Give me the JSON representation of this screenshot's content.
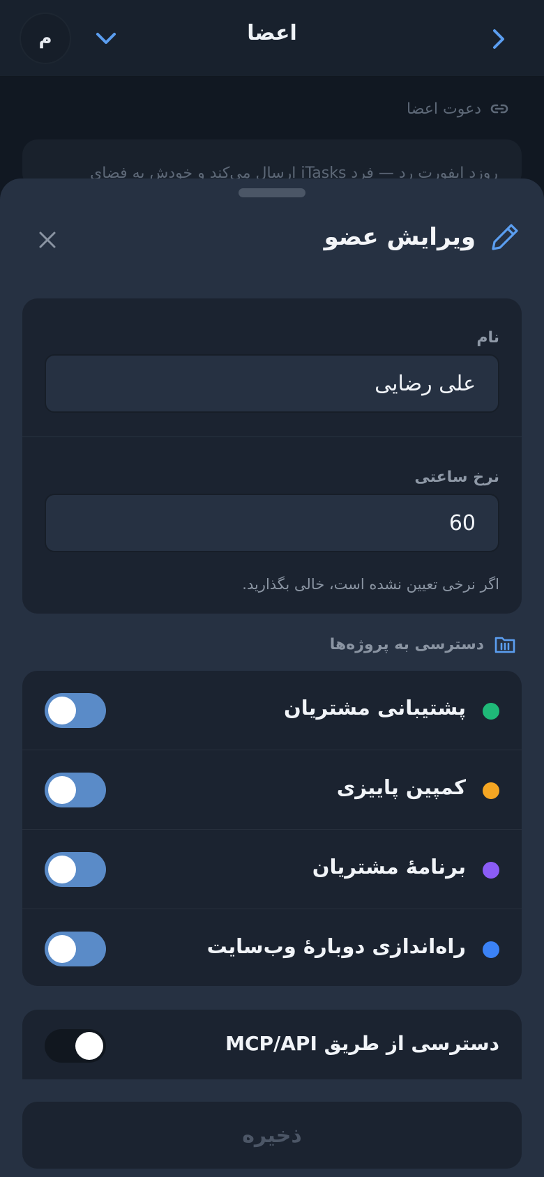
{
  "header": {
    "title": "اعضا",
    "avatar_initial": "م"
  },
  "background": {
    "invite_label": "دعوت اعضا",
    "invite_card_text": "رو‌زد ایفورت رد — فرد iTasks ارسال می‌کند و خودش به فضای"
  },
  "sheet": {
    "title": "ویرایش عضو",
    "name_label": "نام",
    "name_value": "علی رضایی",
    "rate_label": "نرخ ساعتی",
    "rate_value": "60",
    "rate_hint": "اگر نرخی تعیین نشده است، خالی بگذارید.",
    "projects_label": "دسترسی به پروژه‌ها",
    "projects": [
      {
        "name": "پشتیبانی مشتریان",
        "color": "#1fb978",
        "enabled": true
      },
      {
        "name": "کمپین پاییزی",
        "color": "#f5a623",
        "enabled": true
      },
      {
        "name": "برنامهٔ مشتریان",
        "color": "#8b5cf6",
        "enabled": true
      },
      {
        "name": "راه‌اندازی دوبارهٔ وب‌سایت",
        "color": "#3b82f6",
        "enabled": true
      }
    ],
    "mcp_label": "دسترسی از طریق MCP/API",
    "mcp_enabled": false,
    "save_label": "ذخیره"
  },
  "colors": {
    "accent": "#5b9ef0",
    "toggle_on": "#5a8bc8"
  }
}
